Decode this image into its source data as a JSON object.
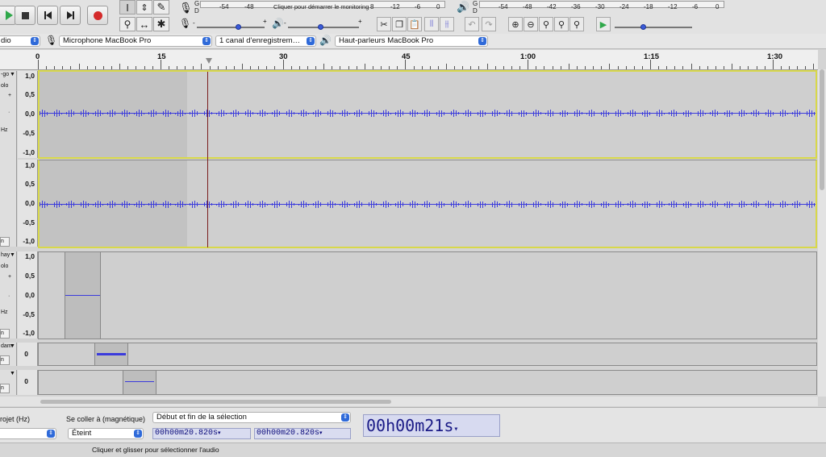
{
  "transport": {
    "play": "play-icon",
    "stop": "stop-icon",
    "skip_start": "skip-start-icon",
    "skip_end": "skip-end-icon",
    "record": "record-icon"
  },
  "meters": {
    "record_channels": [
      "G",
      "D"
    ],
    "record_ticks": [
      "-54",
      "-48",
      "-12",
      "-6",
      "0"
    ],
    "record_prompt": "Cliquer pour démarrer le monitoring",
    "record_prompt_tick": "8",
    "play_channels": [
      "G",
      "D"
    ],
    "play_ticks": [
      "-54",
      "-48",
      "-42",
      "-36",
      "-30",
      "-24",
      "-18",
      "-12",
      "-6",
      "0"
    ]
  },
  "devices": {
    "host": "dio",
    "microphone": "Microphone MacBook Pro",
    "channels": "1 canal d'enregistrem…",
    "speakers": "Haut-parleurs MacBook Pro"
  },
  "ruler": {
    "labels": [
      "0",
      "15",
      "30",
      "45",
      "1:00",
      "1:15",
      "1:30"
    ]
  },
  "tracks": [
    {
      "name": "-go",
      "solo": "olo",
      "extra": "Hz",
      "scale": [
        "1,0",
        "0,5",
        "0,0",
        "-0,5",
        "-1,0"
      ]
    },
    {
      "name": "",
      "solo": "",
      "extra": "",
      "scale": [
        "1,0",
        "0,5",
        "0,0",
        "-0,5",
        "-1,0"
      ]
    },
    {
      "name": "hay",
      "solo": "olo",
      "extra": "Hz",
      "scale": [
        "1,0",
        "0,5",
        "0,0",
        "-0,5",
        "-1,0"
      ]
    },
    {
      "name": "dam",
      "solo": "",
      "extra": "",
      "scale": [
        "0"
      ]
    },
    {
      "name": "",
      "solo": "",
      "extra": "",
      "scale": [
        "0"
      ]
    }
  ],
  "selection": {
    "rate_label": "rojet (Hz)",
    "snap_label": "Se coller à (magnétique)",
    "snap_value": "Éteint",
    "mode_value": "Début et fin de la sélection",
    "start_time": "00h00m20.820s",
    "end_time": "00h00m20.820s",
    "big_time": "00h00m21s"
  },
  "status": "Cliquer et glisser pour sélectionner l'audio",
  "colors": {
    "waveform": "#3b3bdc",
    "cursor": "#7a1f1f",
    "record": "#d42a2a"
  }
}
